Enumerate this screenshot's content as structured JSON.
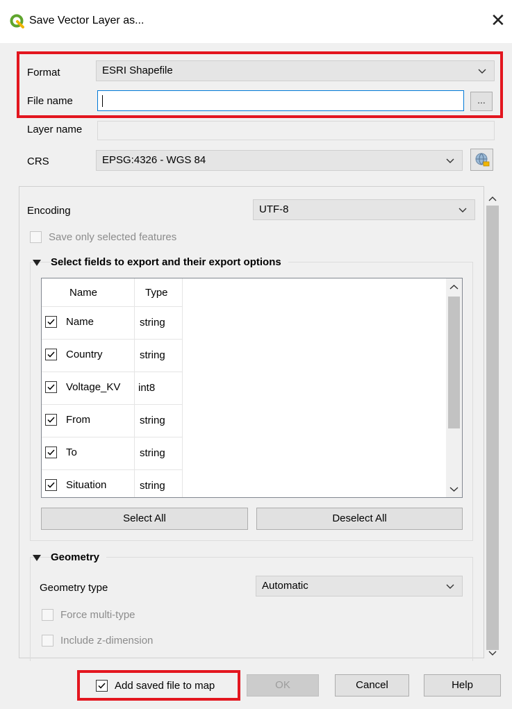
{
  "window": {
    "title": "Save Vector Layer as...",
    "close_glyph": "✕",
    "app_icon": "qgis-q-icon"
  },
  "format": {
    "label": "Format",
    "value": "ESRI Shapefile"
  },
  "file_name": {
    "label": "File name",
    "value": "",
    "browse_label": "..."
  },
  "layer_name": {
    "label": "Layer name",
    "value": ""
  },
  "crs": {
    "label": "CRS",
    "value": "EPSG:4326 - WGS 84",
    "selector_icon": "globe-crs-icon"
  },
  "encoding": {
    "label": "Encoding",
    "value": "UTF-8"
  },
  "save_selected": {
    "label": "Save only selected features",
    "checked": false,
    "enabled": false
  },
  "fields_group": {
    "title": "Select fields to export and their export options",
    "columns": [
      "Name",
      "Type"
    ],
    "rows": [
      {
        "name": "Name",
        "type": "string",
        "checked": true
      },
      {
        "name": "Country",
        "type": "string",
        "checked": true
      },
      {
        "name": "Voltage_KV",
        "type": "int8",
        "checked": true
      },
      {
        "name": "From",
        "type": "string",
        "checked": true
      },
      {
        "name": "To",
        "type": "string",
        "checked": true
      },
      {
        "name": "Situation",
        "type": "string",
        "checked": true
      }
    ],
    "select_all_label": "Select All",
    "deselect_all_label": "Deselect All"
  },
  "geometry_group": {
    "title": "Geometry",
    "type_label": "Geometry type",
    "type_value": "Automatic",
    "force_multi_label": "Force multi-type",
    "include_z_label": "Include z-dimension"
  },
  "footer": {
    "add_to_map_label": "Add saved file to map",
    "add_to_map_checked": true,
    "ok_label": "OK",
    "cancel_label": "Cancel",
    "help_label": "Help"
  },
  "colors": {
    "highlight_frame": "#e3161f",
    "focus_border": "#0078d7",
    "qgis_green": "#5fa52d"
  }
}
